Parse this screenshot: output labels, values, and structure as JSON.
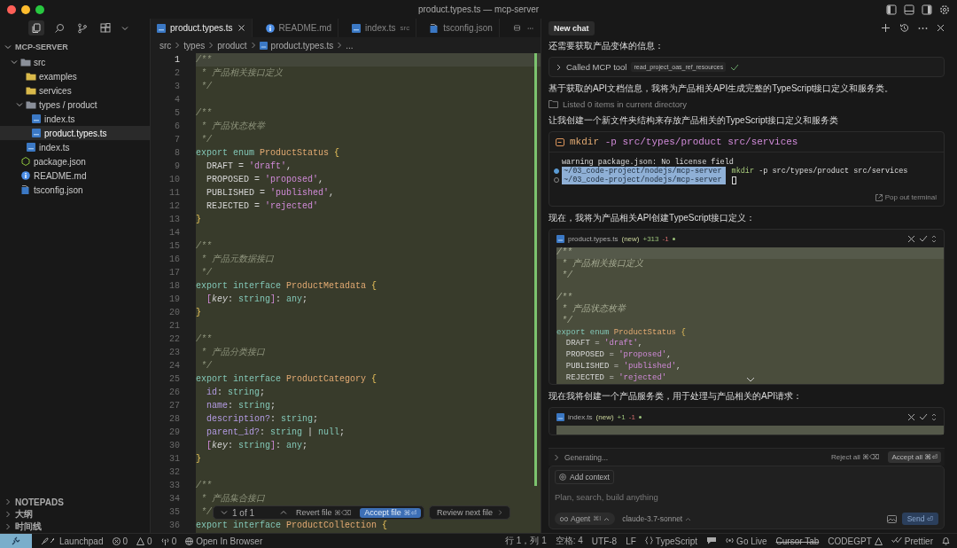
{
  "window": {
    "title": "product.types.ts — mcp-server"
  },
  "activity_bar": [
    {
      "selected": true
    },
    {
      "selected": false
    },
    {
      "selected": false
    },
    {
      "selected": false
    }
  ],
  "explorer": {
    "title": "MCP-SERVER",
    "expanded": true,
    "items": [
      {
        "name": "src",
        "kind": "folder",
        "expanded": true,
        "selected": false,
        "children": [
          {
            "name": "examples",
            "kind": "folder",
            "expanded": false,
            "selected": false
          },
          {
            "name": "services",
            "kind": "folder",
            "expanded": false,
            "selected": false
          },
          {
            "name": "types / product",
            "kind": "folder",
            "expanded": true,
            "selected": false,
            "children": [
              {
                "name": "index.ts",
                "kind": "ts",
                "selected": false
              },
              {
                "name": "product.types.ts",
                "kind": "ts",
                "selected": true
              }
            ]
          },
          {
            "name": "index.ts",
            "kind": "ts",
            "selected": false
          }
        ]
      },
      {
        "name": "package.json",
        "kind": "json",
        "selected": false
      },
      {
        "name": "README.md",
        "kind": "md",
        "selected": false
      },
      {
        "name": "tsconfig.json",
        "kind": "tsconfig",
        "selected": false
      }
    ]
  },
  "side_panels": [
    {
      "title": "NOTEPADS",
      "expanded": false
    },
    {
      "title": "大纲",
      "expanded": false
    },
    {
      "title": "时间线",
      "expanded": false
    }
  ],
  "editor": {
    "tabs": [
      {
        "label": "product.types.ts",
        "kind": "ts",
        "selected": true
      },
      {
        "label": "README.md",
        "kind": "md",
        "selected": false
      },
      {
        "label": "index.ts",
        "detail": "src",
        "kind": "ts",
        "selected": false
      },
      {
        "label": "tsconfig.json",
        "kind": "tsconfig",
        "selected": false
      }
    ],
    "breadcrumbs": [
      "src",
      "types",
      "product",
      "product.types.ts",
      "..."
    ],
    "lines": [
      {
        "n": "1",
        "current": true,
        "tokens": [
          {
            "text": "/**",
            "kind": "c"
          }
        ]
      },
      {
        "n": "2",
        "current": false,
        "tokens": [
          {
            "text": " * 产品相关接口定义",
            "kind": "c"
          }
        ]
      },
      {
        "n": "3",
        "current": false,
        "tokens": [
          {
            "text": " */",
            "kind": "c"
          }
        ]
      },
      {
        "n": "4",
        "current": false
      },
      {
        "n": "5",
        "current": false,
        "tokens": [
          {
            "text": "/**",
            "kind": "c"
          }
        ]
      },
      {
        "n": "6",
        "current": false,
        "tokens": [
          {
            "text": " * 产品状态枚举",
            "kind": "c"
          }
        ]
      },
      {
        "n": "7",
        "current": false,
        "tokens": [
          {
            "text": " */",
            "kind": "c"
          }
        ]
      },
      {
        "n": "8",
        "current": false,
        "tokens": [
          {
            "text": "export enum ",
            "kind": "kw"
          },
          {
            "text": "ProductStatus ",
            "kind": "ty"
          },
          {
            "text": "{",
            "kind": "br"
          }
        ]
      },
      {
        "n": "9",
        "current": false,
        "tokens": [
          {
            "text": "  DRAFT = ",
            "kind": "p"
          },
          {
            "text": "'draft'",
            "kind": "s"
          },
          {
            "text": ",",
            "kind": "p"
          }
        ]
      },
      {
        "n": "10",
        "current": false,
        "tokens": [
          {
            "text": "  PROPOSED = ",
            "kind": "p"
          },
          {
            "text": "'proposed'",
            "kind": "s"
          },
          {
            "text": ",",
            "kind": "p"
          }
        ]
      },
      {
        "n": "11",
        "current": false,
        "tokens": [
          {
            "text": "  PUBLISHED = ",
            "kind": "p"
          },
          {
            "text": "'published'",
            "kind": "s"
          },
          {
            "text": ",",
            "kind": "p"
          }
        ]
      },
      {
        "n": "12",
        "current": false,
        "tokens": [
          {
            "text": "  REJECTED = ",
            "kind": "p"
          },
          {
            "text": "'rejected'",
            "kind": "s"
          }
        ]
      },
      {
        "n": "13",
        "current": false,
        "tokens": [
          {
            "text": "}",
            "kind": "br"
          }
        ]
      },
      {
        "n": "14",
        "current": false
      },
      {
        "n": "15",
        "current": false,
        "tokens": [
          {
            "text": "/**",
            "kind": "c"
          }
        ]
      },
      {
        "n": "16",
        "current": false,
        "tokens": [
          {
            "text": " * 产品元数据接口",
            "kind": "c"
          }
        ]
      },
      {
        "n": "17",
        "current": false,
        "tokens": [
          {
            "text": " */",
            "kind": "c"
          }
        ]
      },
      {
        "n": "18",
        "current": false,
        "tokens": [
          {
            "text": "export interface ",
            "kind": "kw"
          },
          {
            "text": "ProductMetadata ",
            "kind": "ty"
          },
          {
            "text": "{",
            "kind": "br"
          }
        ]
      },
      {
        "n": "19",
        "current": false,
        "tokens": [
          {
            "text": "  [",
            "kind": "s"
          },
          {
            "text": "key",
            "kind": "it"
          },
          {
            "text": ": ",
            "kind": "p"
          },
          {
            "text": "string",
            "kind": "kw"
          },
          {
            "text": "]",
            "kind": "s"
          },
          {
            "text": ": ",
            "kind": "p"
          },
          {
            "text": "any",
            "kind": "kw"
          },
          {
            "text": ";",
            "kind": "p"
          }
        ]
      },
      {
        "n": "20",
        "current": false,
        "tokens": [
          {
            "text": "}",
            "kind": "br"
          }
        ]
      },
      {
        "n": "21",
        "current": false
      },
      {
        "n": "22",
        "current": false,
        "tokens": [
          {
            "text": "/**",
            "kind": "c"
          }
        ]
      },
      {
        "n": "23",
        "current": false,
        "tokens": [
          {
            "text": " * 产品分类接口",
            "kind": "c"
          }
        ]
      },
      {
        "n": "24",
        "current": false,
        "tokens": [
          {
            "text": " */",
            "kind": "c"
          }
        ]
      },
      {
        "n": "25",
        "current": false,
        "tokens": [
          {
            "text": "export interface ",
            "kind": "kw"
          },
          {
            "text": "ProductCategory ",
            "kind": "ty"
          },
          {
            "text": "{",
            "kind": "br"
          }
        ]
      },
      {
        "n": "26",
        "current": false,
        "tokens": [
          {
            "text": "  id",
            "kind": "pr"
          },
          {
            "text": ": ",
            "kind": "p"
          },
          {
            "text": "string",
            "kind": "kw"
          },
          {
            "text": ";",
            "kind": "p"
          }
        ]
      },
      {
        "n": "27",
        "current": false,
        "tokens": [
          {
            "text": "  name",
            "kind": "pr"
          },
          {
            "text": ": ",
            "kind": "p"
          },
          {
            "text": "string",
            "kind": "kw"
          },
          {
            "text": ";",
            "kind": "p"
          }
        ]
      },
      {
        "n": "28",
        "current": false,
        "tokens": [
          {
            "text": "  description?",
            "kind": "pr"
          },
          {
            "text": ": ",
            "kind": "p"
          },
          {
            "text": "string",
            "kind": "kw"
          },
          {
            "text": ";",
            "kind": "p"
          }
        ]
      },
      {
        "n": "29",
        "current": false,
        "tokens": [
          {
            "text": "  parent_id?",
            "kind": "pr"
          },
          {
            "text": ": ",
            "kind": "p"
          },
          {
            "text": "string ",
            "kind": "kw"
          },
          {
            "text": "| ",
            "kind": "p"
          },
          {
            "text": "null",
            "kind": "kw"
          },
          {
            "text": ";",
            "kind": "p"
          }
        ]
      },
      {
        "n": "30",
        "current": false,
        "tokens": [
          {
            "text": "  [",
            "kind": "s"
          },
          {
            "text": "key",
            "kind": "it"
          },
          {
            "text": ": ",
            "kind": "p"
          },
          {
            "text": "string",
            "kind": "kw"
          },
          {
            "text": "]",
            "kind": "s"
          },
          {
            "text": ": ",
            "kind": "p"
          },
          {
            "text": "any",
            "kind": "kw"
          },
          {
            "text": ";",
            "kind": "p"
          }
        ]
      },
      {
        "n": "31",
        "current": false,
        "tokens": [
          {
            "text": "}",
            "kind": "br"
          }
        ]
      },
      {
        "n": "32",
        "current": false
      },
      {
        "n": "33",
        "current": false,
        "tokens": [
          {
            "text": "/**",
            "kind": "c"
          }
        ]
      },
      {
        "n": "34",
        "current": false,
        "tokens": [
          {
            "text": " * 产品集合接口",
            "kind": "c"
          }
        ]
      },
      {
        "n": "35",
        "current": false,
        "tokens": [
          {
            "text": " */",
            "kind": "c"
          }
        ]
      },
      {
        "n": "36",
        "current": false,
        "tokens": [
          {
            "text": "export interface ",
            "kind": "kw"
          },
          {
            "text": "ProductCollection ",
            "kind": "ty"
          },
          {
            "text": "{",
            "kind": "br"
          }
        ]
      }
    ],
    "review": {
      "counter": "1 of 1",
      "revert": "Revert file",
      "revert_keys": "⌘⌫",
      "accept": "Accept file",
      "accept_keys": "⌘⏎",
      "next": "Review next file"
    }
  },
  "chat": {
    "tab": "New chat",
    "messages": [
      {
        "kind": "text",
        "text": "还需要获取产品变体的信息："
      },
      {
        "kind": "tool",
        "label": "Called MCP tool",
        "tool": "read_project_oas_ref_resources",
        "done": true
      },
      {
        "kind": "text",
        "text": "基于获取的API文档信息，我将为产品相关API生成完整的TypeScript接口定义和服务类。"
      },
      {
        "kind": "listing",
        "text": "Listed 0 items in current directory"
      },
      {
        "kind": "text",
        "text": "让我创建一个新文件夹结构来存放产品相关的TypeScript接口定义和服务类"
      },
      {
        "kind": "terminal",
        "program": "mkdir",
        "args": "-p src/types/product src/services",
        "output": "warning package.json: No license field",
        "action": "Pop out terminal",
        "prompts": [
          {
            "path": "~/03_code-project/nodejs/mcp-server",
            "program": "mkdir",
            "args": "-p src/types/product src/services",
            "done": true
          },
          {
            "path": "~/03_code-project/nodejs/mcp-server",
            "done": false
          }
        ]
      },
      {
        "kind": "text",
        "text": "现在，我将为产品相关API创建TypeScript接口定义："
      },
      {
        "kind": "diff",
        "file": "product.types.ts",
        "tag": "(new)",
        "added": "+313",
        "removed": "-1",
        "lines": [
          {
            "kind": "added",
            "tokens": [
              {
                "text": "/**",
                "kind": "c"
              }
            ]
          },
          {
            "kind": "added",
            "tokens": [
              {
                "text": " * 产品相关接口定义",
                "kind": "c"
              }
            ]
          },
          {
            "kind": "added",
            "tokens": [
              {
                "text": " */",
                "kind": "c"
              }
            ]
          },
          {
            "kind": "added"
          },
          {
            "kind": "added",
            "tokens": [
              {
                "text": "/**",
                "kind": "c"
              }
            ]
          },
          {
            "kind": "added",
            "tokens": [
              {
                "text": " * 产品状态枚举",
                "kind": "c"
              }
            ]
          },
          {
            "kind": "added",
            "tokens": [
              {
                "text": " */",
                "kind": "c"
              }
            ]
          },
          {
            "kind": "added",
            "tokens": [
              {
                "text": "export enum ",
                "kind": "kw"
              },
              {
                "text": "ProductStatus ",
                "kind": "ty"
              },
              {
                "text": "{",
                "kind": "br"
              }
            ]
          },
          {
            "kind": "added",
            "tokens": [
              {
                "text": "  DRAFT = ",
                "kind": "p"
              },
              {
                "text": "'draft'",
                "kind": "s"
              },
              {
                "text": ",",
                "kind": "p"
              }
            ]
          },
          {
            "kind": "added",
            "tokens": [
              {
                "text": "  PROPOSED = ",
                "kind": "p"
              },
              {
                "text": "'proposed'",
                "kind": "s"
              },
              {
                "text": ",",
                "kind": "p"
              }
            ]
          },
          {
            "kind": "added",
            "tokens": [
              {
                "text": "  PUBLISHED = ",
                "kind": "p"
              },
              {
                "text": "'published'",
                "kind": "s"
              },
              {
                "text": ",",
                "kind": "p"
              }
            ]
          },
          {
            "kind": "added",
            "tokens": [
              {
                "text": "  REJECTED = ",
                "kind": "p"
              },
              {
                "text": "'rejected'",
                "kind": "s"
              }
            ]
          }
        ]
      },
      {
        "kind": "text",
        "text": "现在我将创建一个产品服务类，用于处理与产品相关的API请求："
      },
      {
        "kind": "diff",
        "file": "index.ts",
        "tag": "(new)",
        "added": "+1",
        "removed": "-1",
        "lines": [
          {
            "kind": "removed"
          }
        ]
      }
    ],
    "generating": {
      "label": "Generating...",
      "reject": "Reject all",
      "reject_keys": "⌘⌫",
      "accept": "Accept all",
      "accept_keys": "⌘⏎"
    },
    "composer": {
      "context": "Add context",
      "placeholder": "Plan, search, build anything",
      "mode": "Agent",
      "mode_keys": "⌘I",
      "model": "claude-3.7-sonnet",
      "send": "Send",
      "send_keys": "⏎"
    }
  },
  "status_bar": {
    "left": [
      {
        "kind": "launchpad",
        "text": "Launchpad"
      },
      {
        "kind": "errors",
        "text": "0"
      },
      {
        "kind": "warnings",
        "text": "0"
      },
      {
        "kind": "ports",
        "text": "0"
      },
      {
        "kind": "browser",
        "text": "Open In Browser"
      }
    ],
    "right": [
      {
        "kind": "plain",
        "text": "行 1，列 1",
        "disabled": false
      },
      {
        "kind": "plain",
        "text": "空格: 4",
        "disabled": false
      },
      {
        "kind": "plain",
        "text": "UTF-8",
        "disabled": false
      },
      {
        "kind": "plain",
        "text": "LF",
        "disabled": false
      },
      {
        "kind": "language",
        "text": "TypeScript",
        "disabled": false
      },
      {
        "kind": "feedback",
        "disabled": false
      },
      {
        "kind": "golive",
        "text": "Go Live",
        "disabled": false
      },
      {
        "kind": "plain",
        "text": "Cursor Tab",
        "disabled": true
      },
      {
        "kind": "codegpt",
        "text": "CODEGPT",
        "disabled": false
      },
      {
        "kind": "prettier",
        "text": "Prettier",
        "disabled": false
      },
      {
        "kind": "bell",
        "disabled": false
      }
    ]
  }
}
